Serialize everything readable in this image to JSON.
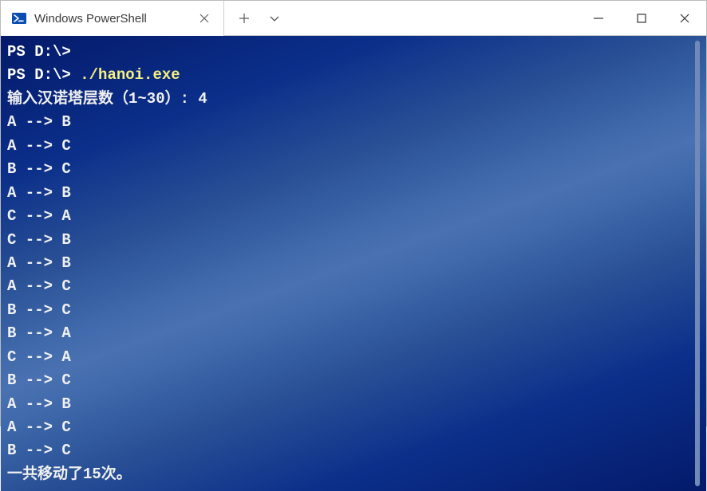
{
  "tab": {
    "title": "Windows PowerShell"
  },
  "terminal": {
    "prompt": "PS D:\\>",
    "command": "./hanoi.exe",
    "input_prompt": "输入汉诺塔层数（1~30）: ",
    "input_value": "4",
    "moves": [
      "A --> B",
      "A --> C",
      "B --> C",
      "A --> B",
      "C --> A",
      "C --> B",
      "A --> B",
      "A --> C",
      "B --> C",
      "B --> A",
      "C --> A",
      "B --> C",
      "A --> B",
      "A --> C",
      "B --> C"
    ],
    "summary_prefix": "一共移动了",
    "summary_count": "15",
    "summary_suffix": "次。"
  }
}
